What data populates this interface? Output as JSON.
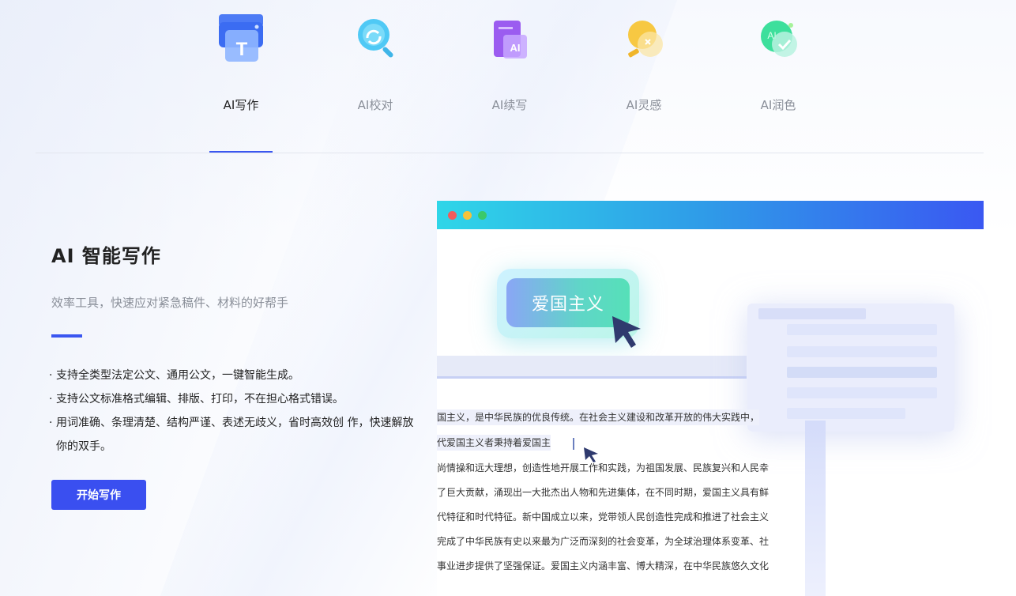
{
  "tabs": [
    {
      "label": "AI写作",
      "icon": "document-write-icon",
      "active": true
    },
    {
      "label": "AI校对",
      "icon": "magnifier-check-icon",
      "active": false
    },
    {
      "label": "AI续写",
      "icon": "ai-document-icon",
      "active": false
    },
    {
      "label": "AI灵感",
      "icon": "lightbulb-icon",
      "active": false
    },
    {
      "label": "AI润色",
      "icon": "check-badge-icon",
      "active": false
    }
  ],
  "feature": {
    "title": "AI 智能写作",
    "subtitle": "效率工具，快速应对紧急稿件、材料的好帮手",
    "points": [
      "支持全类型法定公文、通用公文，一键智能生成。",
      "支持公文标准格式编辑、排版、打印，不在担心格式错误。",
      "用词准确、条理清楚、结构严谨、表述无歧义，省时高效创 作，快速解放",
      "你的双手。"
    ],
    "cta": "开始写作"
  },
  "mockup": {
    "pill_text": "爱国主义",
    "lines": [
      "国主义，是中华民族的优良传统。在社会主义建设和改革开放的伟大实践中，",
      "代爱国主义者秉持着爱国主",
      "尚情操和远大理想，创造性地开展工作和实践，为祖国发展、民族复兴和人民幸",
      "了巨大贡献，涌现出一大批杰出人物和先进集体，在不同时期，爱国主义具有鲜",
      "代特征和时代特征。新中国成立以来，党带领人民创造性完成和推进了社会主义",
      "完成了中华民族有史以来最为广泛而深刻的社会变革，为全球治理体系变革、社",
      "事业进步提供了坚强保证。爱国主义内涵丰富、博大精深，在中华民族悠久文化"
    ]
  },
  "colors": {
    "accent": "#3a56f0",
    "button": "#3a4ff0",
    "window_dot_red": "#f25b5b",
    "window_dot_yellow": "#f5c23a",
    "window_dot_green": "#3ac96a"
  }
}
